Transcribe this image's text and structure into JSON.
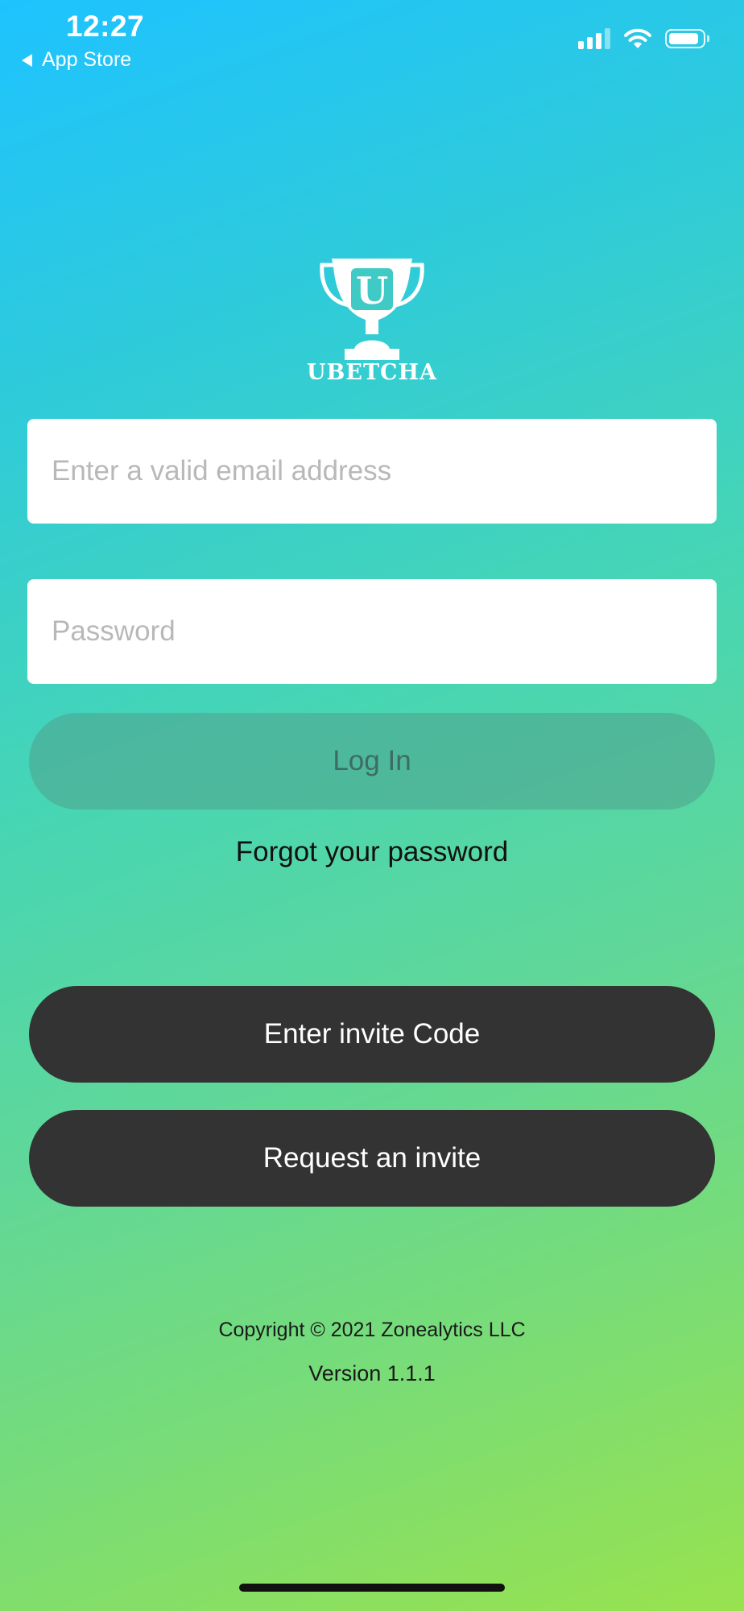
{
  "status_bar": {
    "time": "12:27",
    "back_label": "App Store"
  },
  "logo": {
    "brand": "UBETCHA",
    "trophy_letter": "U"
  },
  "form": {
    "email_placeholder": "Enter a valid email address",
    "email_value": "",
    "password_placeholder": "Password",
    "password_value": "",
    "login_label": "Log In",
    "forgot_label": "Forgot your password"
  },
  "actions": {
    "invite_code_label": "Enter invite Code",
    "request_invite_label": "Request an invite"
  },
  "footer": {
    "copyright": "Copyright © 2021 Zonealytics LLC",
    "version": "Version 1.1.1"
  },
  "colors": {
    "gradient_top": "#1ec3ff",
    "gradient_bottom": "#98e24e",
    "dark_button": "#333333"
  },
  "icons": [
    "back-arrow-icon",
    "signal-icon",
    "wifi-icon",
    "battery-icon",
    "trophy-icon"
  ]
}
